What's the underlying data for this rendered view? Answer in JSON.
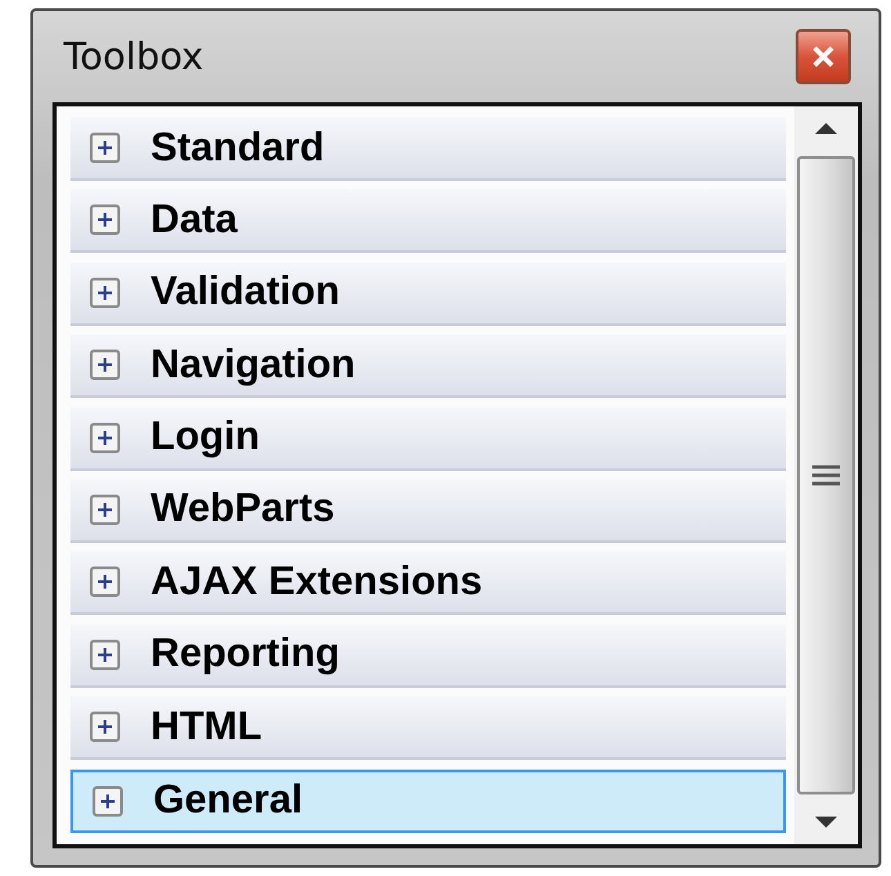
{
  "window": {
    "title": "Toolbox"
  },
  "groups": [
    {
      "label": "Standard",
      "selected": false
    },
    {
      "label": "Data",
      "selected": false
    },
    {
      "label": "Validation",
      "selected": false
    },
    {
      "label": "Navigation",
      "selected": false
    },
    {
      "label": "Login",
      "selected": false
    },
    {
      "label": "WebParts",
      "selected": false
    },
    {
      "label": "AJAX Extensions",
      "selected": false
    },
    {
      "label": "Reporting",
      "selected": false
    },
    {
      "label": "HTML",
      "selected": false
    },
    {
      "label": "General",
      "selected": true
    }
  ]
}
